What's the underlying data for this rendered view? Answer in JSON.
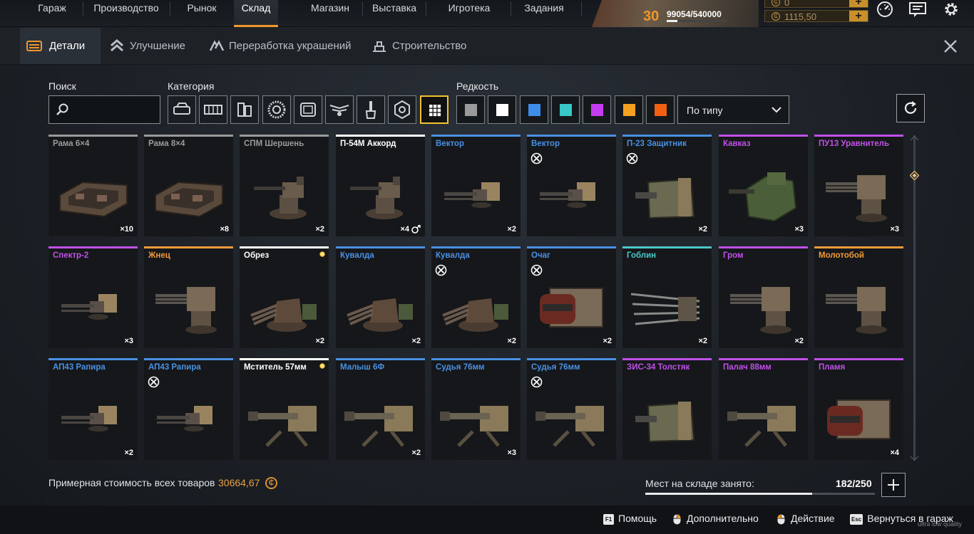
{
  "nav": {
    "items": [
      "Гараж",
      "Производство",
      "Рынок",
      "Склад",
      "Магазин",
      "Выставка",
      "Игротека",
      "Задания"
    ],
    "active": "Склад"
  },
  "player": {
    "level": "30",
    "xp": "99054/540000",
    "xp_progress": 0.18,
    "resource1": "0",
    "resource2": "1115,50"
  },
  "subtabs": {
    "items": [
      "Детали",
      "Улучшение",
      "Переработка украшений",
      "Строительство"
    ],
    "active": "Детали"
  },
  "filters": {
    "search_label": "Поиск",
    "search_placeholder": "",
    "category_label": "Категория",
    "categories": [
      "cabin-icon",
      "frame-icon",
      "module-icon",
      "wheel-icon",
      "cockpit-icon",
      "winged-icon",
      "paint-icon",
      "hexnut-icon",
      "all-grid-icon"
    ],
    "active_category": "all-grid-icon",
    "rarity_label": "Редкость",
    "rarity_colors": [
      "#9a9a9a",
      "#ffffff",
      "#3d8de8",
      "#38c8c8",
      "#c43cf0",
      "#f5a020",
      "#f06010"
    ],
    "sort_value": "По типу"
  },
  "rarity": {
    "common": "#9a9a9a",
    "special": "#ffffff",
    "rare": "#4a90e2",
    "epic": "#c050e8",
    "legendary": "#f09a3a",
    "relic": "#ffffff",
    "teal": "#4cc8c8"
  },
  "items": [
    {
      "name": "Рама 6×4",
      "rarity": "common",
      "qty": "×10",
      "art": "frame"
    },
    {
      "name": "Рама 8×4",
      "rarity": "common",
      "qty": "×8",
      "art": "frame"
    },
    {
      "name": "СПМ Шершень",
      "rarity": "common",
      "qty": "×2",
      "art": "mg"
    },
    {
      "name": "П-54М Аккорд",
      "rarity": "special",
      "qty": "×4",
      "art": "mg",
      "equipped": true
    },
    {
      "name": "Вектор",
      "rarity": "rare",
      "qty": "×2",
      "art": "mgbox"
    },
    {
      "name": "Вектор",
      "rarity": "rare",
      "qty": "",
      "art": "mgbox",
      "mod": true
    },
    {
      "name": "П-23 Защитник",
      "rarity": "rare",
      "qty": "×2",
      "art": "turret",
      "mod": true
    },
    {
      "name": "Кавказ",
      "rarity": "epic",
      "qty": "×3",
      "art": "turretgreen"
    },
    {
      "name": "ПУ13 Уравнитель",
      "rarity": "epic",
      "qty": "×3",
      "art": "minigun"
    },
    {
      "name": "Спектр-2",
      "rarity": "epic",
      "qty": "×3",
      "art": "mgbox"
    },
    {
      "name": "Жнец",
      "rarity": "legendary",
      "qty": "",
      "art": "minigun"
    },
    {
      "name": "Обрез",
      "rarity": "special",
      "qty": "×2",
      "art": "shotgun",
      "star": true
    },
    {
      "name": "Кувалда",
      "rarity": "rare",
      "qty": "×2",
      "art": "shotgun"
    },
    {
      "name": "Кувалда",
      "rarity": "rare",
      "qty": "×2",
      "art": "shotgun",
      "mod": true
    },
    {
      "name": "Очаг",
      "rarity": "rare",
      "qty": "×2",
      "art": "barrel",
      "mod": true
    },
    {
      "name": "Гоблин",
      "rarity": "teal",
      "qty": "×2",
      "art": "spikes"
    },
    {
      "name": "Гром",
      "rarity": "epic",
      "qty": "×2",
      "art": "minigun"
    },
    {
      "name": "Молотобой",
      "rarity": "legendary",
      "qty": "",
      "art": "minigun"
    },
    {
      "name": "АП43 Рапира",
      "rarity": "rare",
      "qty": "×2",
      "art": "mgbox"
    },
    {
      "name": "АП43 Рапира",
      "rarity": "rare",
      "qty": "",
      "art": "mgbox",
      "mod": true
    },
    {
      "name": "Мститель 57мм",
      "rarity": "special",
      "qty": "",
      "art": "cannon",
      "star": true
    },
    {
      "name": "Малыш 6Ф",
      "rarity": "rare",
      "qty": "×2",
      "art": "cannon"
    },
    {
      "name": "Судья 76мм",
      "rarity": "rare",
      "qty": "×3",
      "art": "cannon"
    },
    {
      "name": "Судья 76мм",
      "rarity": "rare",
      "qty": "",
      "art": "cannon",
      "mod": true
    },
    {
      "name": "ЗИС-34 Толстяк",
      "rarity": "epic",
      "qty": "",
      "art": "turret"
    },
    {
      "name": "Палач 88мм",
      "rarity": "epic",
      "qty": "",
      "art": "cannon"
    },
    {
      "name": "Пламя",
      "rarity": "epic",
      "qty": "×4",
      "art": "barrel"
    }
  ],
  "bottom": {
    "total_label": "Примерная стоимость всех товаров",
    "total_value": "30664,67",
    "storage_label": "Мест на складе занято:",
    "storage_value": "182/250",
    "storage_fraction": 0.728
  },
  "footer": {
    "help_key": "F1",
    "help": "Помощь",
    "more": "Дополнительно",
    "action": "Действие",
    "back_key": "Esc",
    "back": "Вернуться в гараж",
    "quality": "ultra low quality"
  }
}
